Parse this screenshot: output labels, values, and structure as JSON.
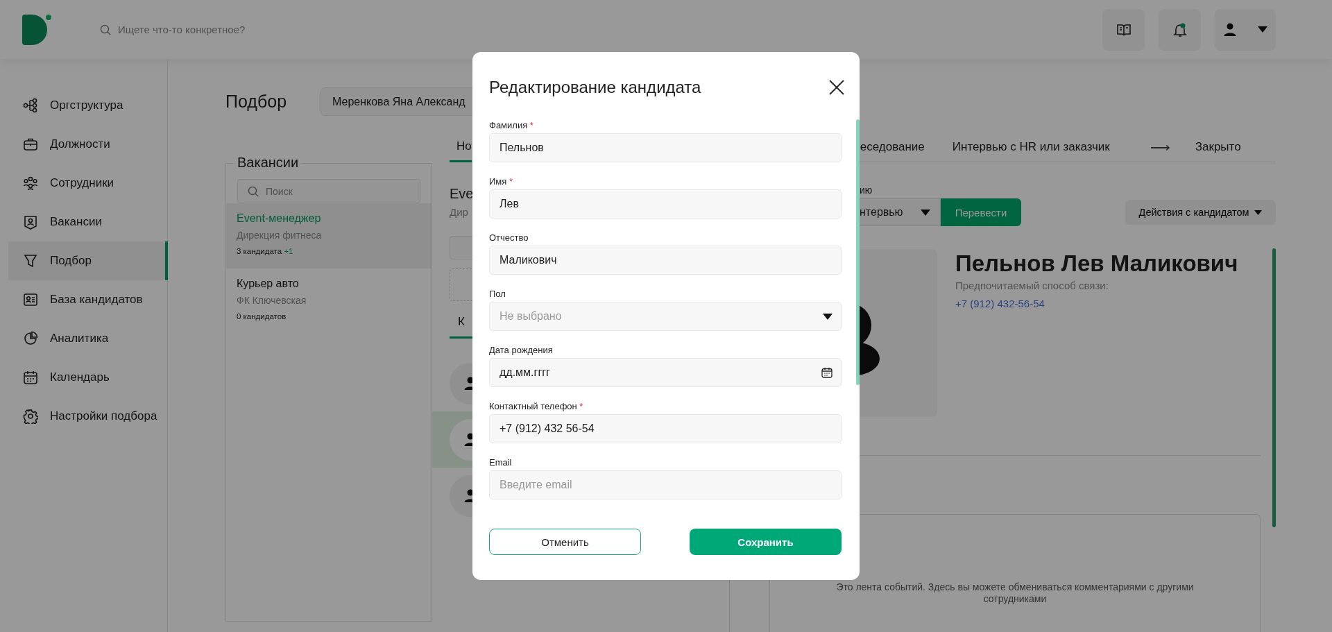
{
  "search": {
    "placeholder": "Ищете что-то конкретное?"
  },
  "notifications": {
    "unread": true
  },
  "sidebar": {
    "items": [
      {
        "label": "Оргструктура",
        "selected": false
      },
      {
        "label": "Должности",
        "selected": false
      },
      {
        "label": "Сотрудники",
        "selected": false
      },
      {
        "label": "Вакансии",
        "selected": false
      },
      {
        "label": "Подбор",
        "selected": true
      },
      {
        "label": "База кандидатов",
        "selected": false
      },
      {
        "label": "Аналитика",
        "selected": false
      },
      {
        "label": "Календарь",
        "selected": false
      },
      {
        "label": "Настройки подбора",
        "selected": false
      }
    ]
  },
  "page": {
    "title": "Подбор",
    "recruiter_select": {
      "value": "Меренкова Яна Александ"
    }
  },
  "stage_tabs": [
    {
      "kind": "tab",
      "label": "Но",
      "selected": true
    },
    {
      "kind": "tab",
      "label": "еседование",
      "selected": false
    },
    {
      "kind": "tab",
      "label": "Интервью с HR или заказчик",
      "selected": false
    },
    {
      "kind": "arrow",
      "label": "⟶"
    },
    {
      "kind": "tab",
      "label": "Закрыто",
      "selected": false
    }
  ],
  "vacancies": {
    "title": "Вакансии",
    "search": {
      "placeholder": "Поиск"
    },
    "items": [
      {
        "title": "Event-менеджер",
        "department": "Дирекция фитнеса",
        "count": "3 кандидата",
        "new_count": "+1",
        "selected": true
      },
      {
        "title": "Курьер авто",
        "department": "ФК Ключевская",
        "count": "0 кандидатов",
        "selected": false
      }
    ]
  },
  "vacancy_detail": {
    "title": "Eve",
    "subtitle": "Дир",
    "tabs": [
      {
        "label": "К",
        "selected": true
      }
    ],
    "candidates": [
      {
        "selected": false
      },
      {
        "selected": true
      },
      {
        "selected": false
      }
    ]
  },
  "candidate": {
    "stage_label": "ию",
    "stage_select": {
      "value": "нтервью"
    },
    "move_button": "Перевести",
    "actions_button": "Действия с кандидатом",
    "name": "Пельнов Лев Маликович",
    "contact_label": "Предпочитаемый способ связи:",
    "contact_phone": "+7 (912) 432-56-54",
    "events_hint": "Это лента событий. Здесь вы можете обмениваться комментариями с другими сотрудниками"
  },
  "modal": {
    "title": "Редактирование кандидата",
    "fields": [
      {
        "kind": "text",
        "label": "Фамилия",
        "required_mark": "*",
        "value": "Пельнов"
      },
      {
        "kind": "text",
        "label": "Имя",
        "required_mark": "*",
        "value": "Лев"
      },
      {
        "kind": "text",
        "label": "Отчество",
        "value": "Маликович"
      },
      {
        "kind": "select",
        "label": "Пол",
        "placeholder": "Не выбрано"
      },
      {
        "kind": "date",
        "label": "Дата рождения",
        "value": "дд.мм.гггг"
      },
      {
        "kind": "text",
        "label": "Контактный телефон",
        "required_mark": "*",
        "value": "+7 (912) 432 56-54"
      },
      {
        "kind": "text",
        "label": "Email",
        "placeholder": "Введите email"
      }
    ],
    "buttons": [
      {
        "kind": "secondary",
        "label": "Отменить"
      },
      {
        "kind": "primary",
        "label": "Сохранить"
      }
    ]
  }
}
